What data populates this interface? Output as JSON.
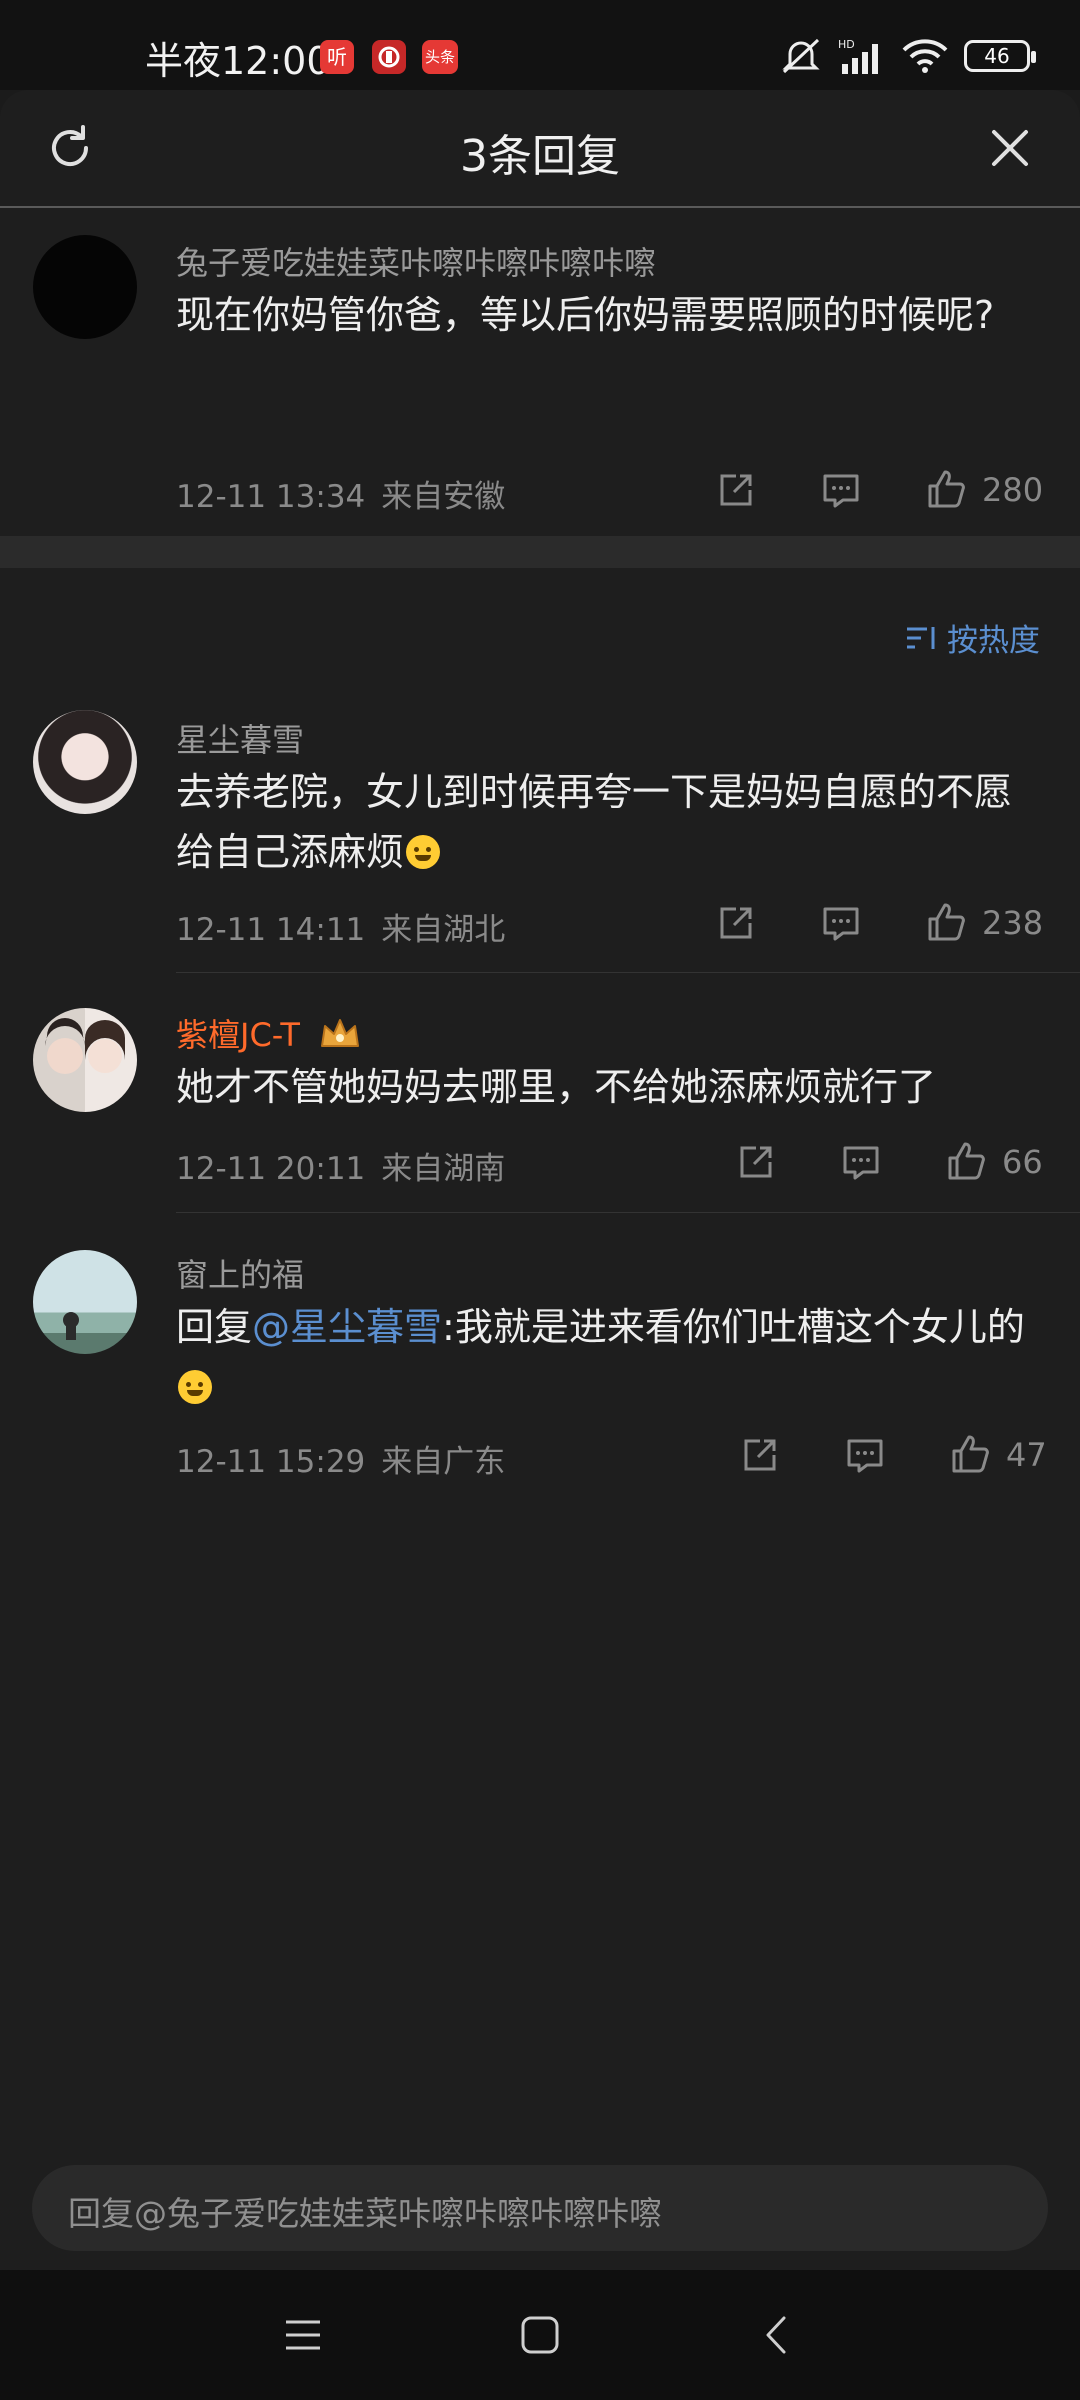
{
  "status_bar": {
    "time": "半夜12:00",
    "apps": [
      {
        "label": "听",
        "color": "#e53935"
      },
      {
        "label": "",
        "color": "#d32f2f"
      },
      {
        "label": "头条",
        "color": "#e53935"
      }
    ],
    "network": "HD",
    "battery": "46"
  },
  "header": {
    "title": "3条回复"
  },
  "parent_comment": {
    "username": "兔子爱吃娃娃菜咔嚓咔嚓咔嚓咔嚓",
    "text": "现在你妈管你爸，等以后你妈需要照顾的时候呢?",
    "time": "12-11 13:34",
    "location": "来自安徽",
    "likes": "280"
  },
  "sort": {
    "label": "按热度"
  },
  "replies": [
    {
      "username": "星尘暮雪",
      "text": "去养老院，女儿到时候再夸一下是妈妈自愿的不愿给自己添麻烦",
      "time": "12-11 14:11",
      "location": "来自湖北",
      "likes": "238"
    },
    {
      "username": "紫檀JC-T",
      "username_color": "#ff6a2b",
      "text": "她才不管她妈妈去哪里，不给她添麻烦就行了",
      "time": "12-11 20:11",
      "location": "来自湖南",
      "likes": "66"
    },
    {
      "username": "窗上的福",
      "reply_prefix": "回复",
      "mention": "@星尘暮雪",
      "text": ":我就是进来看你们吐槽这个女儿的",
      "time": "12-11 15:29",
      "location": "来自广东",
      "likes": "47"
    }
  ],
  "reply_input": {
    "placeholder": "回复@兔子爱吃娃娃菜咔嚓咔嚓咔嚓咔嚓"
  },
  "colors": {
    "accent_blue": "#5b8fd0",
    "vip_orange": "#ff6a2b",
    "background": "#1e1e1e"
  }
}
